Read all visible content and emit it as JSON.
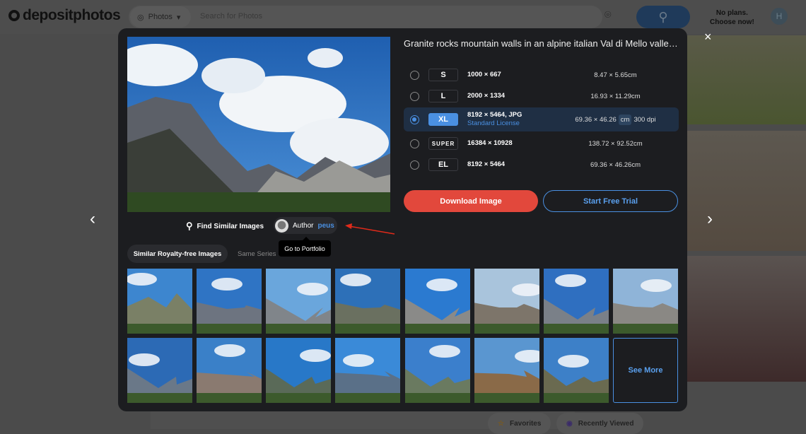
{
  "header": {
    "logo": "depositphotos",
    "search_type": "Photos",
    "search_placeholder": "Search for Photos",
    "plans_line1": "No plans.",
    "plans_line2": "Choose now!",
    "avatar_letter": "H"
  },
  "modal": {
    "title": "Granite rocks mountain walls in an alpine italian Val di Mello valley ...",
    "sizes": [
      {
        "label": "S",
        "pixels": "1000 × 667",
        "print": "8.47 × 5.65cm",
        "selected": false
      },
      {
        "label": "L",
        "pixels": "2000 × 1334",
        "print": "16.93 × 11.29cm",
        "selected": false
      },
      {
        "label": "XL",
        "pixels": "8192 × 5464, JPG",
        "license": "Standard License",
        "print": "69.36 × 46.26",
        "unit": "cm",
        "dpi": "300 dpi",
        "selected": true
      },
      {
        "label": "SUPER",
        "pixels": "16384 × 10928",
        "print": "138.72 × 92.52cm",
        "selected": false
      },
      {
        "label": "EL",
        "pixels": "8192 × 5464",
        "print": "69.36 × 46.26cm",
        "selected": false
      }
    ],
    "download_label": "Download Image",
    "trial_label": "Start Free Trial",
    "find_similar": "Find Similar Images",
    "author_prefix": "Author",
    "author_name": "peus",
    "tooltip": "Go to Portfolio",
    "tabs": [
      "Similar Royalty-free Images",
      "Same Series"
    ],
    "see_more": "See More",
    "close": "×",
    "prev": "‹",
    "next": "›"
  },
  "bottom": {
    "favorites": "Favorites",
    "recently_viewed": "Recently Viewed"
  },
  "colors": {
    "accent": "#4a90e2",
    "download": "#e2483c",
    "modal_bg": "#1c1d20"
  }
}
